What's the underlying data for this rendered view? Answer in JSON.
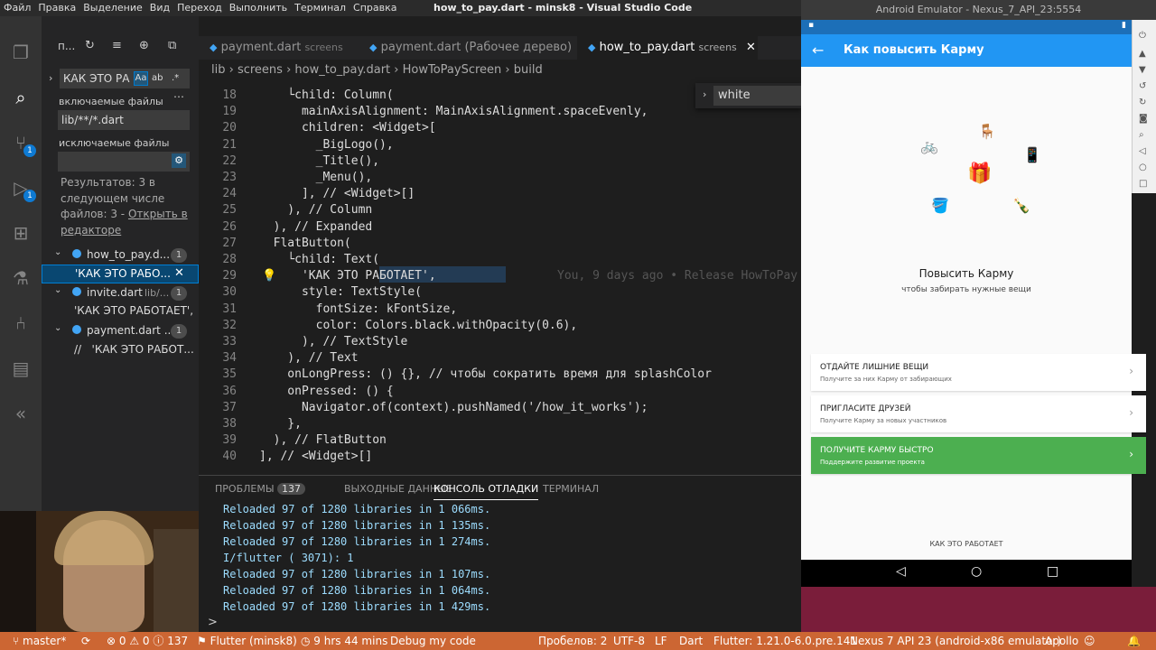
{
  "window": {
    "title": "how_to_pay.dart - minsk8 - Visual Studio Code"
  },
  "menu": [
    "Файл",
    "Правка",
    "Выделение",
    "Вид",
    "Переход",
    "Выполнить",
    "Терминал",
    "Справка"
  ],
  "activity": {
    "scm_badge": "1",
    "debug_badge": "1"
  },
  "sidebar": {
    "header": "п...",
    "search_value": "КАК ЭТО РА",
    "case_btn": "Aa",
    "word_btn": "ab",
    "regex_btn": ".*",
    "include_label": "включаемые файлы",
    "include_value": "lib/**/*.dart",
    "exclude_label": "исключаемые файлы",
    "results_text": "Результатов: 3 в следующем числе файлов: 3 -",
    "results_link": "Открыть в редакторе",
    "files": [
      {
        "name": "how_to_pay.d...",
        "count": "1",
        "match": "'КАК ЭТО РАБО..."
      },
      {
        "name": "invite.dart",
        "path": "lib/...",
        "count": "1",
        "match": "'КАК ЭТО РАБОТАЕТ',"
      },
      {
        "name": "payment.dart ...",
        "count": "1",
        "match": "//   'КАК ЭТО РАБОТ..."
      }
    ]
  },
  "tabs": [
    {
      "name": "payment.dart",
      "desc": "screens"
    },
    {
      "name": "payment.dart (Рабочее дерево)",
      "desc": ""
    },
    {
      "name": "how_to_pay.dart",
      "desc": "screens"
    }
  ],
  "breadcrumb": [
    "lib",
    "screens",
    "how_to_pay.dart",
    "HowToPayScreen",
    "build"
  ],
  "find_widget": {
    "value": "white"
  },
  "code": {
    "blame": "You, 9 days ago • Release HowToPay",
    "lines": [
      {
        "n": "18",
        "t": "    └child: Column("
      },
      {
        "n": "19",
        "t": "      mainAxisAlignment: MainAxisAlignment.spaceEvenly,"
      },
      {
        "n": "20",
        "t": "      children: <Widget>["
      },
      {
        "n": "21",
        "t": "        _BigLogo(),"
      },
      {
        "n": "22",
        "t": "        _Title(),"
      },
      {
        "n": "23",
        "t": "        _Menu(),"
      },
      {
        "n": "24",
        "t": "      ], // <Widget>[]"
      },
      {
        "n": "25",
        "t": "    ), // Column"
      },
      {
        "n": "26",
        "t": "  ), // Expanded"
      },
      {
        "n": "27",
        "t": "  FlatButton("
      },
      {
        "n": "28",
        "t": "    └child: Text("
      },
      {
        "n": "29",
        "t": "      'КАК ЭТО РАБОТАЕТ',"
      },
      {
        "n": "30",
        "t": "      style: TextStyle("
      },
      {
        "n": "31",
        "t": "        fontSize: kFontSize,"
      },
      {
        "n": "32",
        "t": "        color: Colors.black.withOpacity(0.6),"
      },
      {
        "n": "33",
        "t": "      ), // TextStyle"
      },
      {
        "n": "34",
        "t": "    ), // Text"
      },
      {
        "n": "35",
        "t": "    onLongPress: () {}, // чтобы сократить время для splashColor"
      },
      {
        "n": "36",
        "t": "    onPressed: () {"
      },
      {
        "n": "37",
        "t": "      Navigator.of(context).pushNamed('/how_it_works');"
      },
      {
        "n": "38",
        "t": "    },"
      },
      {
        "n": "39",
        "t": "  ), // FlatButton"
      },
      {
        "n": "40",
        "t": "], // <Widget>[]"
      }
    ]
  },
  "panel": {
    "tabs": [
      "ПРОБЛЕМЫ",
      "ВЫХОДНЫЕ ДАННЫЕ",
      "КОНСОЛЬ ОТЛАДКИ",
      "ТЕРМИНАЛ"
    ],
    "problems_count": "137",
    "console": [
      "Reloaded 97 of 1280 libraries in 1 066ms.",
      "Reloaded 97 of 1280 libraries in 1 135ms.",
      "Reloaded 97 of 1280 libraries in 1 274ms.",
      "I/flutter ( 3071): 1",
      "Reloaded 97 of 1280 libraries in 1 107ms.",
      "Reloaded 97 of 1280 libraries in 1 064ms.",
      "Reloaded 97 of 1280 libraries in 1 429ms."
    ],
    "prompt": ">"
  },
  "status": {
    "branch": "master*",
    "sync": "⟳",
    "errors": "0",
    "warnings": "0",
    "info": "137",
    "flutter": "Flutter (minsk8)",
    "time": "9 hrs 44 mins",
    "debug": "Debug my code",
    "spaces": "Пробелов: 2",
    "encoding": "UTF-8",
    "eol": "LF",
    "lang": "Dart",
    "flutter_ver": "Flutter: 1.21.0-6.0.pre.141",
    "device": "Nexus 7 API 23 (android-x86 emulator)",
    "apollo": "Apollo"
  },
  "emulator": {
    "title": "Android Emulator - Nexus_7_API_23:5554",
    "appbar_title": "Как повысить Карму",
    "hero_title": "Повысить Карму",
    "hero_sub": "чтобы забирать нужные вещи",
    "cards": [
      {
        "title": "ОТДАЙТЕ ЛИШНИЕ ВЕЩИ",
        "sub": "Получите за них Карму от забирающих"
      },
      {
        "title": "ПРИГЛАСИТЕ ДРУЗЕЙ",
        "sub": "Получите Карму за новых участников"
      },
      {
        "title": "ПОЛУЧИТЕ КАРМУ БЫСТРО",
        "sub": "Поддержите развитие проекта"
      }
    ],
    "footer_btn": "КАК ЭТО РАБОТАЕТ"
  },
  "colors": {
    "status": "#cc6633",
    "accent": "#2196f3",
    "green": "#4caf50",
    "orange": "#f06a2a"
  }
}
